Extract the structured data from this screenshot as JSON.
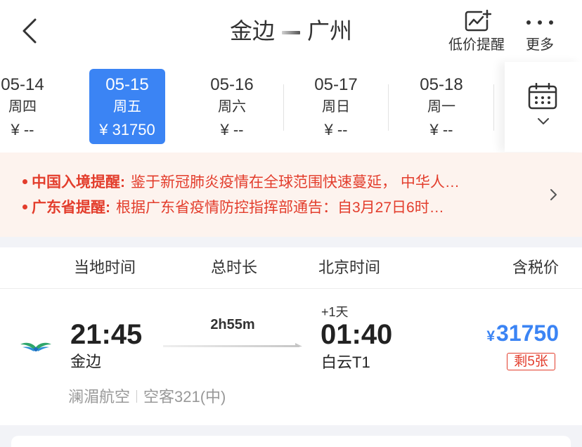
{
  "header": {
    "back_icon": "chevron-left-icon",
    "origin": "金边",
    "destination": "广州",
    "price_alert_icon": "price-alert-chart-icon",
    "price_alert_label": "低价提醒",
    "more_icon": "more-dots-icon",
    "more_label": "更多"
  },
  "dates": [
    {
      "date": "05-14",
      "weekday": "周四",
      "price": "¥ --"
    },
    {
      "date": "05-15",
      "weekday": "周五",
      "price": "¥ 31750",
      "selected": true
    },
    {
      "date": "05-16",
      "weekday": "周六",
      "price": "¥ --"
    },
    {
      "date": "05-17",
      "weekday": "周日",
      "price": "¥ --"
    },
    {
      "date": "05-18",
      "weekday": "周一",
      "price": "¥ --"
    }
  ],
  "calendar": {
    "icon": "calendar-icon",
    "expand_icon": "chevron-down-icon"
  },
  "notices": [
    {
      "title": "中国入境提醒:",
      "text": "鉴于新冠肺炎疫情在全球范围快速蔓延， 中华人…"
    },
    {
      "title": "广东省提醒:",
      "text": "根据广东省疫情防控指挥部通告：自3月27日6时…"
    }
  ],
  "notice_more_icon": "chevron-right-icon",
  "columns": {
    "local_time": "当地时间",
    "duration": "总时长",
    "beijing_time": "北京时间",
    "price": "含税价"
  },
  "flight": {
    "airline_logo": "airline-wing-logo-icon",
    "depart_time": "21:45",
    "depart_airport": "金边",
    "duration": "2h55m",
    "day_offset": "+1天",
    "arrive_time": "01:40",
    "arrive_airport": "白云T1",
    "currency": "¥",
    "price": "31750",
    "seats_left": "剩5张",
    "airline": "澜湄航空",
    "aircraft": "空客321(中)"
  },
  "colors": {
    "accent": "#3b84f4",
    "alert": "#e33d2c",
    "notice_bg": "#fdf3ee",
    "page_bg": "#f2f3f7"
  }
}
